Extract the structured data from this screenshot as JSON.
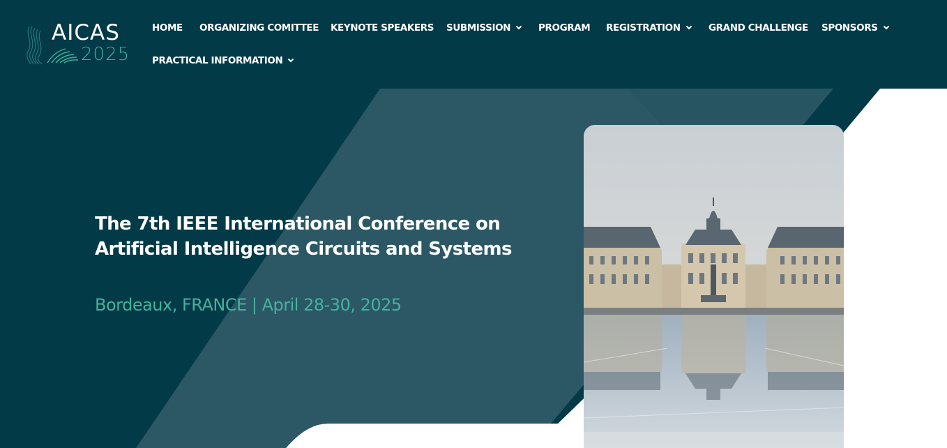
{
  "brand": {
    "name": "AICAS",
    "year": "2025",
    "colors": {
      "header_bg": "#023a47",
      "accent": "#45b29d",
      "panel": "#2d5a66"
    }
  },
  "nav": {
    "items": [
      {
        "label": "HOME",
        "dropdown": false
      },
      {
        "label": "ORGANIZING COMITTEE",
        "dropdown": false
      },
      {
        "label": "KEYNOTE SPEAKERS",
        "dropdown": false
      },
      {
        "label": "SUBMISSION",
        "dropdown": true
      },
      {
        "label": "PROGRAM",
        "dropdown": false
      },
      {
        "label": "REGISTRATION",
        "dropdown": true
      },
      {
        "label": "GRAND CHALLENGE",
        "dropdown": false
      },
      {
        "label": "SPONSORS",
        "dropdown": true
      },
      {
        "label": "PRACTICAL INFORMATION",
        "dropdown": true
      }
    ]
  },
  "hero": {
    "title_line1": "The 7th IEEE International Conference on",
    "title_line2": "Artificial Intelligence Circuits and Systems",
    "subtitle": "Bordeaux, FRANCE | April 28-30, 2025"
  },
  "icons": {
    "dropdown": "chevron-down-icon",
    "logo": "waveform-logo-icon"
  }
}
